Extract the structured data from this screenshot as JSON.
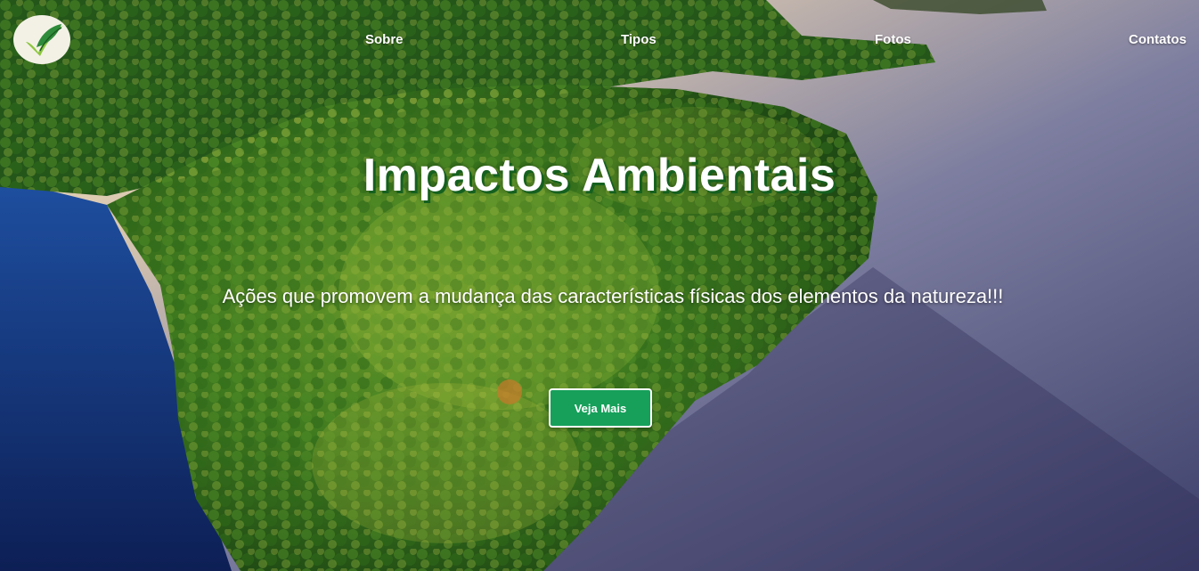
{
  "nav": {
    "items": [
      {
        "label": "Sobre"
      },
      {
        "label": "Tipos"
      },
      {
        "label": "Fotos"
      },
      {
        "label": "Contatos"
      }
    ]
  },
  "hero": {
    "title": "Impactos Ambientais",
    "subtitle": "Ações que promovem a mudança das características físicas dos elementos da natureza!!!",
    "button_label": "Veja Mais"
  },
  "colors": {
    "button": "#16a05a",
    "title_shadow": "#15601f",
    "logo_leaf": "#2e8b3a",
    "logo_bg": "#f3f1e6"
  },
  "icons": {
    "logo": "leaf-check-icon"
  }
}
